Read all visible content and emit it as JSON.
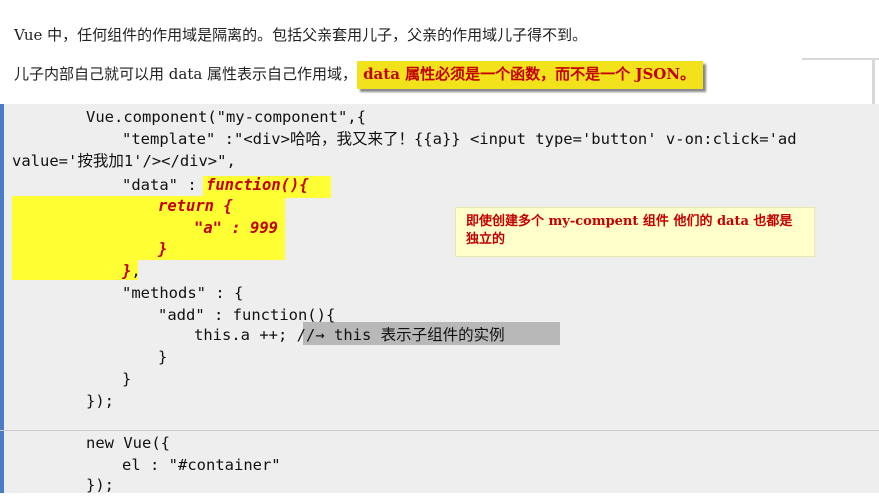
{
  "intro": {
    "line1": "Vue 中，任何组件的作用域是隔离的。包括父亲套用儿子，父亲的作用域儿子得不到。",
    "line2_prefix": "儿子内部自己就可以用 data 属性表示自己作用域，",
    "line2_highlight": "data 属性必须是一个函数，而不是一个 JSON。"
  },
  "code": {
    "l1": "Vue.component(\"my-component\",{",
    "l2": "\"template\" :\"<div>哈哈，我又来了！{{a}} <input type='button' v-on:click='ad",
    "l3": "value='按我加1'/></div>\",",
    "l4_key": "\"data\" : ",
    "l4_fn": "function(){",
    "l5": "return {",
    "l6": "\"a\" : 999",
    "l7": "}",
    "l8_brace": "}",
    "l8_comma": ",",
    "l9": "\"methods\" : {",
    "l10": "\"add\" : function(){",
    "l11_code": "this.a ++;",
    "l11_comment": "//→ this 表示子组件的实例",
    "l12": "}",
    "l13": "}",
    "l14": "});",
    "l15": "new Vue({",
    "l16": "el : \"#container\"",
    "l17": "});"
  },
  "note": {
    "text": "即使创建多个 my-compent 组件 他们的 data 也都是独立的"
  },
  "colors": {
    "highlight_yellow": "#ffff33",
    "accent_red": "#c40000",
    "code_bg": "#eeeeee",
    "left_border": "#4a7cc7"
  }
}
